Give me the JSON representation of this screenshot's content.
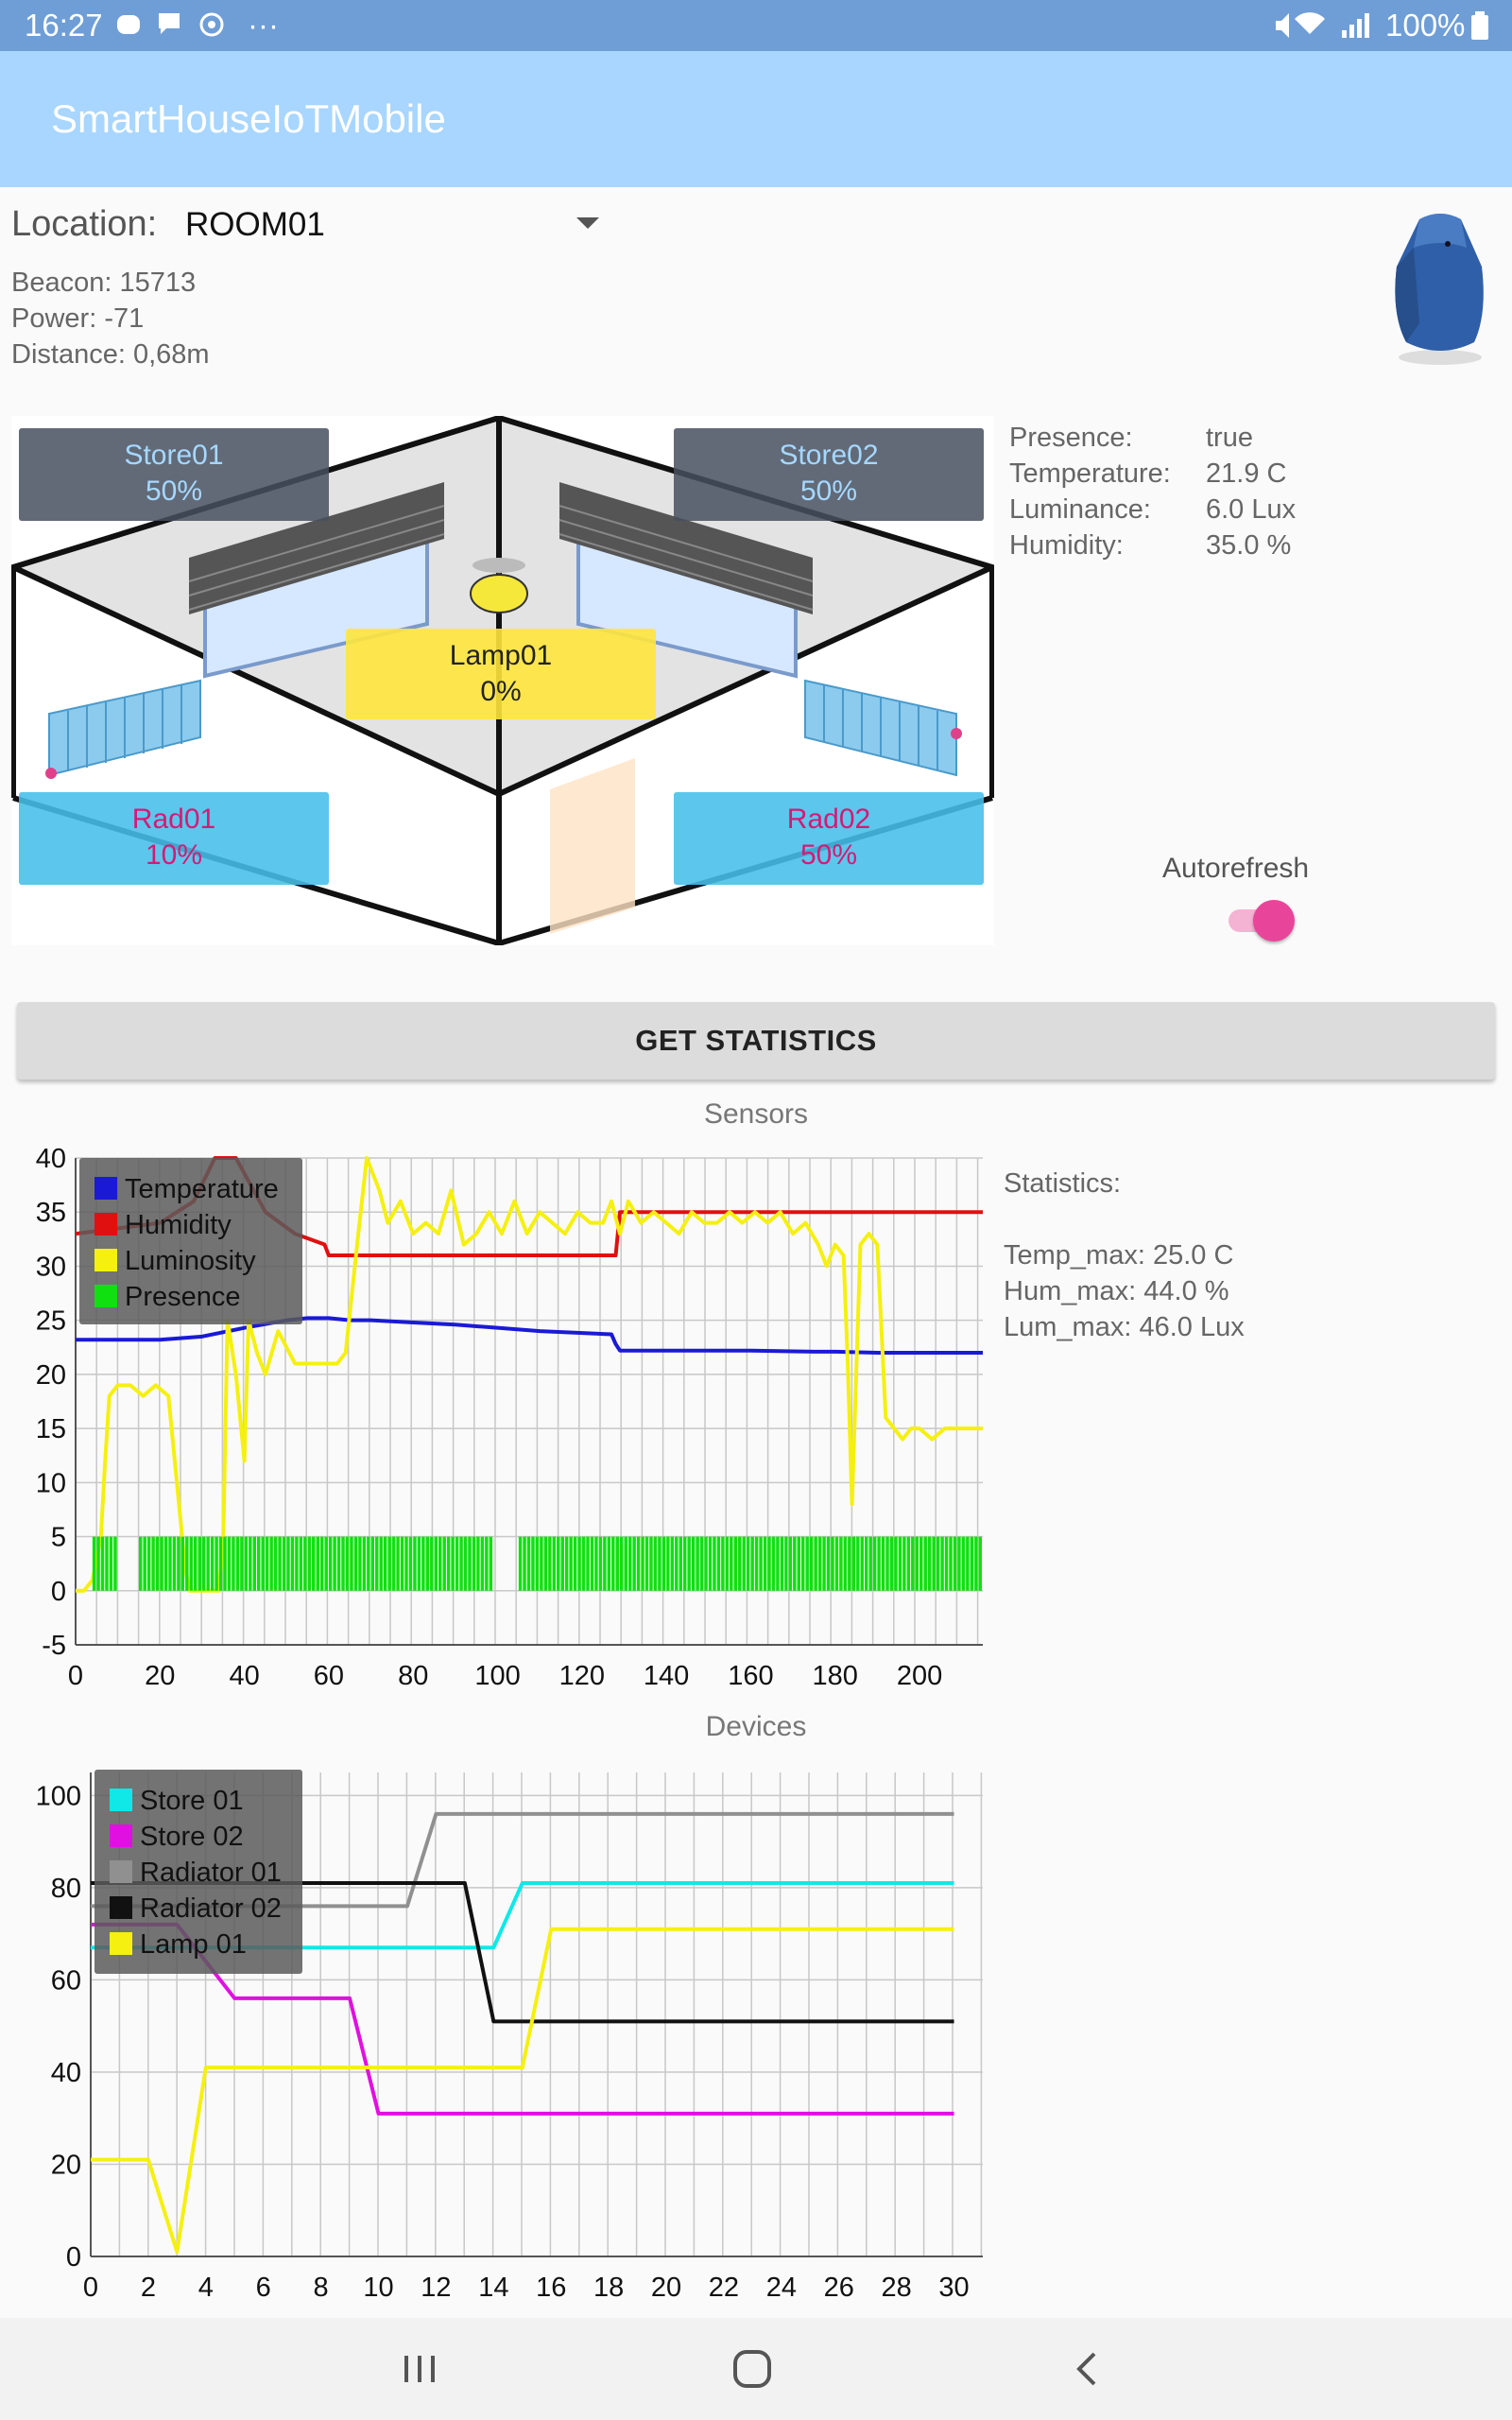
{
  "status_bar": {
    "time": "16:27",
    "more": "···",
    "battery": "100%"
  },
  "app": {
    "title": "SmartHouseIoTMobile"
  },
  "location": {
    "label": "Location:",
    "value": "ROOM01"
  },
  "beacon": {
    "beacon": "Beacon: 15713",
    "power": "Power: -71",
    "distance": "Distance: 0,68m"
  },
  "devices": {
    "store01": {
      "name": "Store01",
      "value": "50%"
    },
    "store02": {
      "name": "Store02",
      "value": "50%"
    },
    "lamp01": {
      "name": "Lamp01",
      "value": "0%"
    },
    "rad01": {
      "name": "Rad01",
      "value": "10%"
    },
    "rad02": {
      "name": "Rad02",
      "value": "50%"
    }
  },
  "sensors_panel": [
    {
      "key": "Presence:",
      "value": "true"
    },
    {
      "key": "Temperature:",
      "value": "21.9 C"
    },
    {
      "key": "Luminance:",
      "value": "6.0 Lux"
    },
    {
      "key": "Humidity:",
      "value": "35.0 %"
    }
  ],
  "autorefresh": {
    "label": "Autorefresh",
    "on": true,
    "accent": "#e8459a"
  },
  "get_statistics": "GET STATISTICS",
  "statistics": {
    "title": "Statistics:",
    "temp_max": "Temp_max: 25.0 C",
    "hum_max": "Hum_max: 44.0 %",
    "lum_max": "Lum_max: 46.0 Lux"
  },
  "chart_data": [
    {
      "type": "line",
      "title": "Sensors",
      "xlim": [
        0,
        215
      ],
      "ylim": [
        -5,
        40
      ],
      "xticks": [
        0,
        20,
        40,
        60,
        80,
        100,
        120,
        140,
        160,
        180,
        200
      ],
      "yticks": [
        -5,
        0,
        5,
        10,
        15,
        20,
        25,
        30,
        35,
        40
      ],
      "grid": true,
      "legend_position": "top-left",
      "series": [
        {
          "name": "Temperature",
          "color": "#1a1ad6",
          "x": [
            0,
            20,
            30,
            40,
            50,
            55,
            60,
            65,
            70,
            80,
            90,
            100,
            110,
            127,
            128,
            129,
            140,
            160,
            175,
            180,
            190,
            200,
            215
          ],
          "y": [
            23.2,
            23.2,
            23.5,
            24.3,
            25,
            25.2,
            25.2,
            25,
            25,
            24.8,
            24.6,
            24.3,
            24,
            23.7,
            22.8,
            22.2,
            22.2,
            22.2,
            22.1,
            22.1,
            22,
            22,
            22
          ]
        },
        {
          "name": "Humidity",
          "color": "#e01010",
          "x": [
            0,
            20,
            28,
            33,
            38,
            45,
            52,
            59,
            60,
            70,
            80,
            90,
            100,
            110,
            128,
            129,
            140,
            160,
            180,
            200,
            215
          ],
          "y": [
            33,
            34,
            36,
            40,
            40,
            35,
            33,
            32,
            31,
            31,
            31,
            31,
            31,
            31,
            31,
            35,
            35,
            35,
            35,
            35,
            35
          ]
        },
        {
          "name": "Luminosity",
          "color": "#f5f010",
          "x": [
            0,
            2,
            4,
            6,
            7,
            8,
            10,
            13,
            16,
            19,
            22,
            24,
            26,
            27,
            29,
            32,
            34,
            35,
            36,
            38,
            40,
            41,
            43,
            45,
            48,
            52,
            56,
            60,
            62,
            64,
            67,
            69,
            70,
            72,
            74,
            77,
            80,
            83,
            86,
            89,
            92,
            95,
            98,
            101,
            104,
            107,
            110,
            113,
            116,
            119,
            122,
            125,
            127,
            129,
            131,
            134,
            137,
            140,
            143,
            146,
            149,
            152,
            155,
            158,
            161,
            164,
            167,
            170,
            173,
            176,
            178,
            180,
            182,
            183,
            184,
            186,
            188,
            190,
            192,
            194,
            196,
            198,
            200,
            203,
            206,
            209,
            212,
            215
          ],
          "y": [
            0,
            0,
            1,
            5,
            12,
            18,
            19,
            19,
            18,
            19,
            18,
            10,
            2,
            0,
            0,
            0,
            0,
            5,
            25,
            20,
            12,
            25,
            22,
            20,
            24,
            21,
            21,
            21,
            21,
            22,
            33,
            40,
            39,
            37,
            34,
            36,
            33,
            34,
            33,
            37,
            32,
            33,
            35,
            33,
            36,
            33,
            35,
            34,
            33,
            35,
            34,
            34,
            36,
            33,
            36,
            34,
            35,
            34,
            33,
            35,
            34,
            34,
            35,
            34,
            35,
            34,
            35,
            33,
            34,
            32,
            30,
            32,
            31,
            21,
            8,
            32,
            33,
            32,
            16,
            15,
            14,
            15,
            15,
            14,
            15,
            15,
            15,
            15
          ]
        },
        {
          "name": "Presence",
          "color": "#10e010",
          "x": [
            0,
            3,
            4,
            4,
            10,
            10,
            15,
            15,
            99,
            99,
            105,
            105,
            215
          ],
          "y": [
            0,
            0,
            0,
            5,
            5,
            0,
            0,
            5,
            5,
            0,
            0,
            5,
            5
          ]
        }
      ]
    },
    {
      "type": "line",
      "title": "Devices",
      "xlim": [
        0,
        31
      ],
      "ylim": [
        0,
        105
      ],
      "xticks": [
        0,
        2,
        4,
        6,
        8,
        10,
        12,
        14,
        16,
        18,
        20,
        22,
        24,
        26,
        28,
        30
      ],
      "yticks": [
        0,
        20,
        40,
        60,
        80,
        100
      ],
      "grid": true,
      "legend_position": "top-left",
      "series": [
        {
          "name": "Store 01",
          "color": "#10e8e8",
          "x": [
            0,
            14,
            15,
            30
          ],
          "y": [
            67,
            67,
            81,
            81
          ]
        },
        {
          "name": "Store 02",
          "color": "#e010e0",
          "x": [
            0,
            3,
            5,
            9,
            10,
            30
          ],
          "y": [
            72,
            72,
            56,
            56,
            31,
            31
          ]
        },
        {
          "name": "Radiator 01",
          "color": "#909090",
          "x": [
            0,
            11,
            12,
            30
          ],
          "y": [
            76,
            76,
            96,
            96
          ]
        },
        {
          "name": "Radiator 02",
          "color": "#111111",
          "x": [
            0,
            13,
            14,
            30
          ],
          "y": [
            81,
            81,
            51,
            51
          ]
        },
        {
          "name": "Lamp 01",
          "color": "#f5f010",
          "x": [
            0,
            2,
            3,
            4,
            15,
            16,
            30
          ],
          "y": [
            21,
            21,
            1,
            41,
            41,
            71,
            71
          ]
        }
      ]
    }
  ]
}
